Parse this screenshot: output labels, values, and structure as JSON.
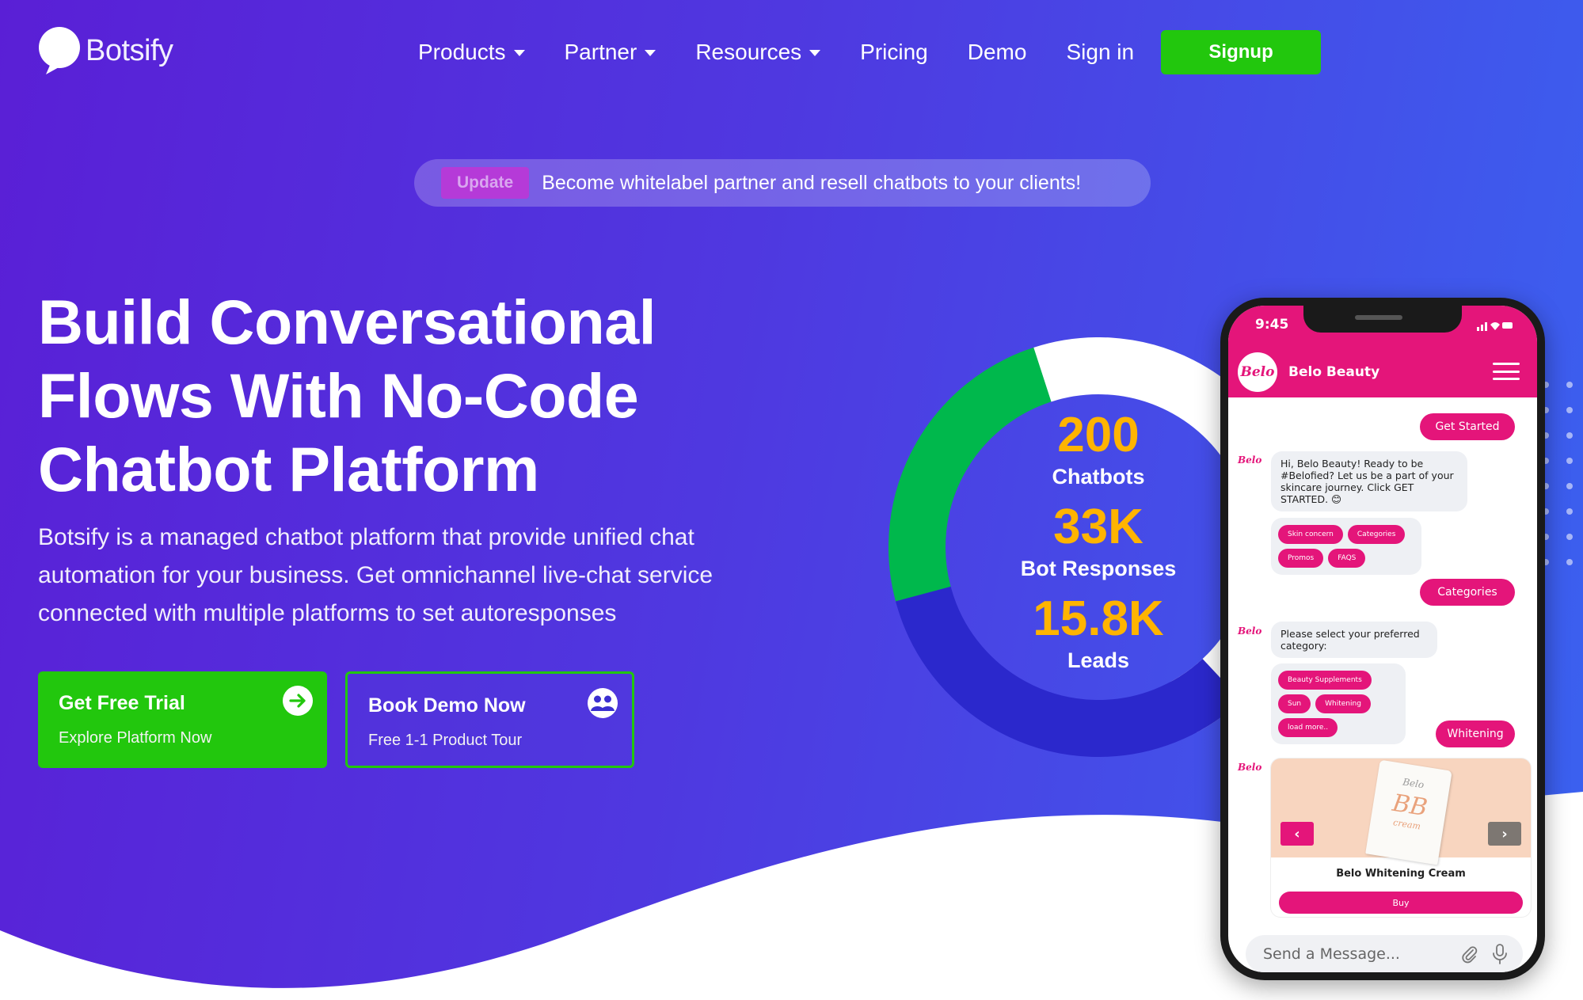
{
  "brand": {
    "name": "Botsify"
  },
  "nav": {
    "items": [
      {
        "label": "Products",
        "dropdown": true
      },
      {
        "label": "Partner",
        "dropdown": true
      },
      {
        "label": "Resources",
        "dropdown": true
      },
      {
        "label": "Pricing",
        "dropdown": false
      },
      {
        "label": "Demo",
        "dropdown": false
      },
      {
        "label": "Sign in",
        "dropdown": false
      }
    ],
    "signup_label": "Signup"
  },
  "banner": {
    "badge": "Update",
    "text": "Become whitelabel partner and resell chatbots to your clients!"
  },
  "hero": {
    "title_lines": [
      "Build Conversational",
      "Flows With No-Code",
      "Chatbot Platform"
    ],
    "description_lines": [
      "Botsify is a managed chatbot platform that provide unified chat",
      "automation for your business. Get omnichannel live-chat service",
      "connected with multiple platforms to set autoresponses"
    ]
  },
  "cta": {
    "primary": {
      "title": "Get Free Trial",
      "subtitle": "Explore Platform Now",
      "icon": "arrow-right-icon"
    },
    "secondary": {
      "title": "Book Demo Now",
      "subtitle": "Free 1-1 Product Tour",
      "icon": "users-icon"
    }
  },
  "stats": [
    {
      "value": "200",
      "label": "Chatbots"
    },
    {
      "value": "33K",
      "label": "Bot Responses"
    },
    {
      "value": "15.8K",
      "label": "Leads"
    }
  ],
  "phone": {
    "time": "9:45",
    "chat_name": "Belo Beauty",
    "logo_text": "Belo",
    "messages": {
      "get_started": "Get Started",
      "greeting": "Hi, Belo Beauty! Ready to be #Belofied? Let us be a part of your skincare journey. Click GET STARTED. 😊",
      "quick_replies_1": [
        "Skin concern",
        "Categories",
        "Promos",
        "FAQS"
      ],
      "categories": "Categories",
      "select_prompt": "Please select your preferred category:",
      "quick_replies_2": [
        "Beauty Supplements",
        "Sun",
        "Whitening",
        "load more.."
      ],
      "whitening": "Whitening"
    },
    "card": {
      "title": "Belo Whitening Cream",
      "buy_label": "Buy",
      "product_brand": "Belo",
      "product_name": "BB",
      "product_sub": "cream"
    },
    "input_placeholder": "Send a Message..."
  },
  "colors": {
    "accent_green": "#22c70d",
    "stat_yellow": "#ffb400",
    "belo_pink": "#e4157a",
    "donut_green": "#00b84c",
    "donut_navy": "#2b28cc",
    "donut_white": "#ffffff"
  }
}
